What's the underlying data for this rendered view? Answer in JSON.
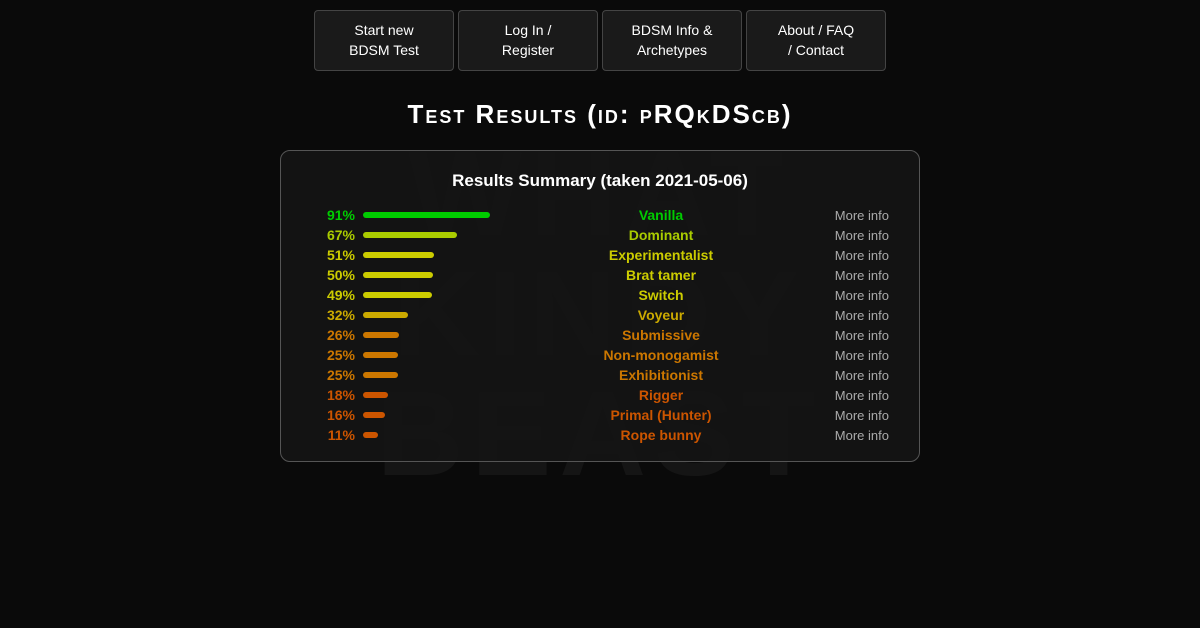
{
  "nav": {
    "buttons": [
      {
        "id": "start-test",
        "label": "Start new\nBDSM Test"
      },
      {
        "id": "log-in",
        "label": "Log In /\nRegister"
      },
      {
        "id": "bdsm-info",
        "label": "BDSM Info &\nArchetypes"
      },
      {
        "id": "about-faq",
        "label": "About / FAQ\n/ Contact"
      }
    ]
  },
  "page_title": "Test Results (id: pRQkDScb)",
  "results": {
    "heading": "Results Summary (taken 2021-05-06)",
    "rows": [
      {
        "pct": "91%",
        "pct_val": 91,
        "label": "Vanilla",
        "color_class": "color-green",
        "bar_class": "bar-green"
      },
      {
        "pct": "67%",
        "pct_val": 67,
        "label": "Dominant",
        "color_class": "color-yellow-green",
        "bar_class": "bar-yellow-green"
      },
      {
        "pct": "51%",
        "pct_val": 51,
        "label": "Experimentalist",
        "color_class": "color-yellow",
        "bar_class": "bar-yellow"
      },
      {
        "pct": "50%",
        "pct_val": 50,
        "label": "Brat tamer",
        "color_class": "color-yellow",
        "bar_class": "bar-yellow"
      },
      {
        "pct": "49%",
        "pct_val": 49,
        "label": "Switch",
        "color_class": "color-yellow",
        "bar_class": "bar-yellow"
      },
      {
        "pct": "32%",
        "pct_val": 32,
        "label": "Voyeur",
        "color_class": "color-orange-yellow",
        "bar_class": "bar-orange-yellow"
      },
      {
        "pct": "26%",
        "pct_val": 26,
        "label": "Submissive",
        "color_class": "color-orange",
        "bar_class": "bar-orange"
      },
      {
        "pct": "25%",
        "pct_val": 25,
        "label": "Non-monogamist",
        "color_class": "color-orange",
        "bar_class": "bar-orange"
      },
      {
        "pct": "25%",
        "pct_val": 25,
        "label": "Exhibitionist",
        "color_class": "color-orange",
        "bar_class": "bar-orange"
      },
      {
        "pct": "18%",
        "pct_val": 18,
        "label": "Rigger",
        "color_class": "color-orange-red",
        "bar_class": "bar-orange-red"
      },
      {
        "pct": "16%",
        "pct_val": 16,
        "label": "Primal (Hunter)",
        "color_class": "color-orange-red",
        "bar_class": "bar-orange-red"
      },
      {
        "pct": "11%",
        "pct_val": 11,
        "label": "Rope bunny",
        "color_class": "color-orange-red",
        "bar_class": "bar-orange-red"
      }
    ],
    "more_info_label": "More info"
  },
  "watermark_lines": [
    "WHAT",
    "KINKY",
    "BEAST"
  ]
}
